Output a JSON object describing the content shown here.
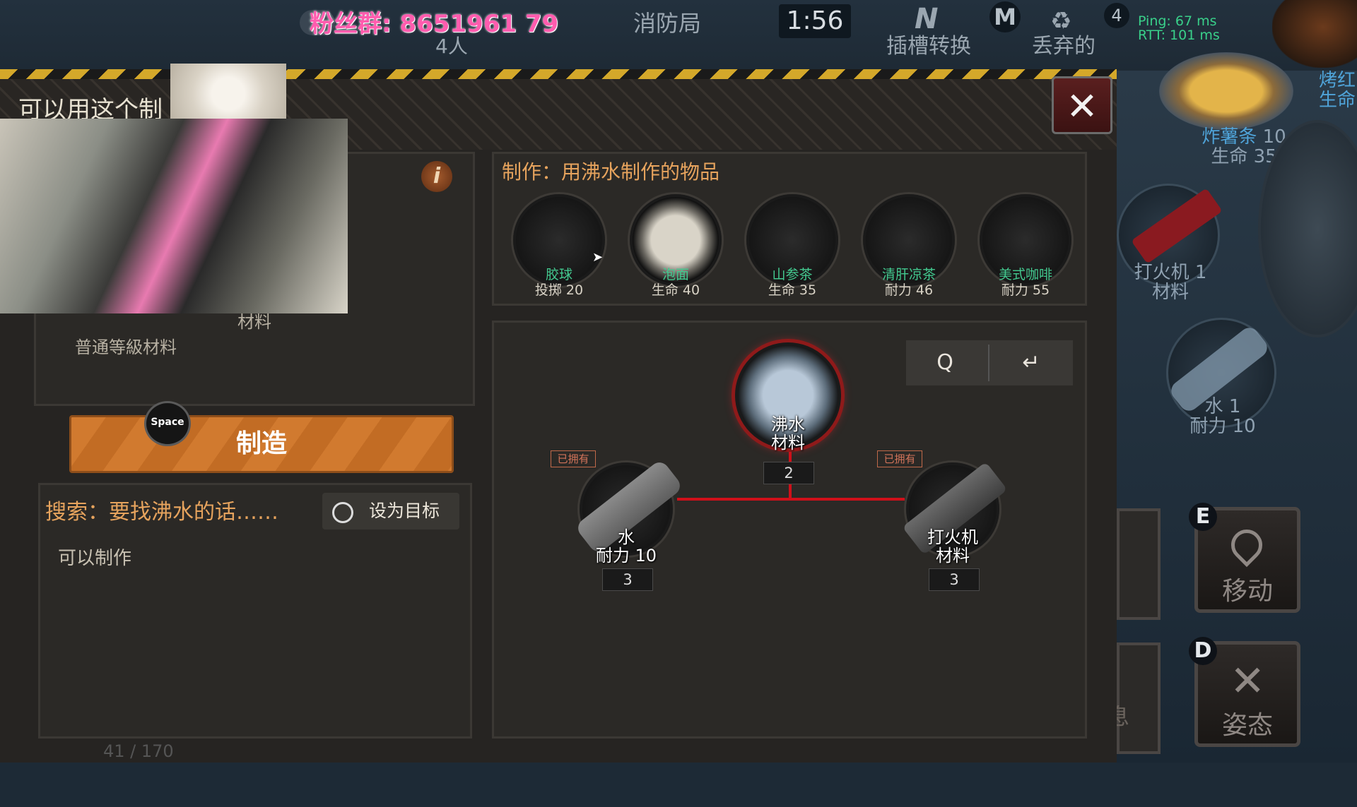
{
  "hud": {
    "fan_group": "粉丝群: 8651961 79",
    "players": "4人",
    "location": "消防局",
    "timer": "1:56",
    "slot_switch_key": "N",
    "slot_switch": "插槽转换",
    "map_key": "M",
    "discard": "丢弃的",
    "count": "4",
    "ping": "Ping: 67 ms",
    "rtt": "RTT: 101 ms"
  },
  "side": {
    "roast_label": "烤红",
    "roast_stat": "生命",
    "fries_name": "炸薯条",
    "fries_qty": "10",
    "fries_stat": "生命 35",
    "lighter": "打火机 1",
    "lighter_sub": "材料",
    "water": "水 1",
    "water_stat": "耐力 10",
    "move_key": "E",
    "move_label": "移动",
    "stance_key": "D",
    "stance_label": "姿态",
    "bottom_text": "息"
  },
  "window": {
    "hint": "可以用这个制",
    "close": "✕",
    "item_name": "材料",
    "item_desc": "普通等級材料",
    "info_icon": "i",
    "space_key": "Space",
    "craft_label": "制造",
    "search_title": "搜索：要找沸水的话……",
    "target_label": "设为目标",
    "can_craft": "可以制作",
    "pager": "41 / 170"
  },
  "recipes": {
    "title": "制作：用沸水制作的物品",
    "items": [
      {
        "name": "胶球",
        "stat": "投掷 20",
        "icon": "rubber-ball-icon"
      },
      {
        "name": "泡面",
        "stat": "生命 40",
        "icon": "instant-noodle-icon"
      },
      {
        "name": "山参茶",
        "stat": "生命 35",
        "icon": "ginseng-tea-icon"
      },
      {
        "name": "清肝凉茶",
        "stat": "耐力 46",
        "icon": "herbal-tea-icon"
      },
      {
        "name": "美式咖啡",
        "stat": "耐力 55",
        "icon": "americano-icon"
      }
    ]
  },
  "tree": {
    "search_tool": "Q",
    "back_tool": "↵",
    "root": {
      "name": "沸水",
      "sub": "材料",
      "qty": "2"
    },
    "left": {
      "name": "水",
      "sub": "耐力 10",
      "qty": "3",
      "owned": "已拥有"
    },
    "right": {
      "name": "打火机",
      "sub": "材料",
      "qty": "3",
      "owned": "已拥有"
    }
  },
  "colors": {
    "accent": "#e6a35d",
    "owned": "#d3745a",
    "link": "#d0101a",
    "name_green": "#43c98f"
  }
}
